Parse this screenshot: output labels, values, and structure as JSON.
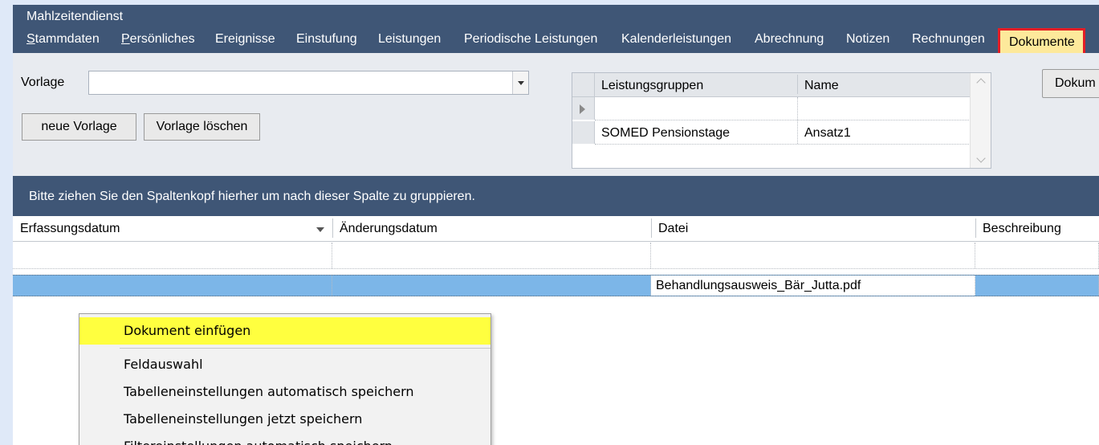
{
  "header": {
    "module_title": "Mahlzeitendienst",
    "tabs": [
      {
        "label": "Stammdaten",
        "mnemonic": "S",
        "rest": "tammdaten"
      },
      {
        "label": "Persönliches",
        "mnemonic": "P",
        "rest": "ersönliches"
      },
      {
        "label": "Ereignisse"
      },
      {
        "label": "Einstufung"
      },
      {
        "label": "Leistungen"
      },
      {
        "label": "Periodische Leistungen"
      },
      {
        "label": "Kalenderleistungen"
      },
      {
        "label": "Abrechnung"
      },
      {
        "label": "Notizen"
      },
      {
        "label": "Rechnungen"
      },
      {
        "label": "Dokumente",
        "active": true
      }
    ]
  },
  "form": {
    "vorlage_label": "Vorlage",
    "vorlage_value": "",
    "new_template_button": "neue Vorlage",
    "delete_template_button": "Vorlage löschen",
    "dokum_button": "Dokum"
  },
  "group_grid": {
    "columns": [
      "Leistungsgruppen",
      "Name"
    ],
    "rows": [
      [
        "",
        ""
      ],
      [
        "SOMED Pensionstage",
        "Ansatz1"
      ]
    ]
  },
  "group_panel": {
    "hint": "Bitte ziehen Sie den Spaltenkopf hierher um nach dieser Spalte zu gruppieren."
  },
  "table": {
    "columns": [
      "Erfassungsdatum",
      "Änderungsdatum",
      "Datei",
      "Beschreibung"
    ],
    "rows": [
      [
        "",
        "",
        "",
        ""
      ],
      [
        "",
        "",
        "Behandlungsausweis_Bär_Jutta.pdf",
        ""
      ]
    ]
  },
  "context_menu": {
    "items": [
      {
        "label": "Dokument einfügen",
        "highlighted": true
      },
      {
        "label": "Feldauswahl"
      },
      {
        "label": "Tabelleneinstellungen automatisch speichern"
      },
      {
        "label": "Tabelleneinstellungen jetzt speichern"
      },
      {
        "label": "Filtereinstellungen automatisch speichern"
      }
    ]
  },
  "colors": {
    "header_bg": "#3f5676",
    "active_tab_bg": "#fde99b",
    "active_tab_border": "#e41e25",
    "selected_row": "#7cb6e8",
    "menu_highlight": "#ffff3f"
  }
}
